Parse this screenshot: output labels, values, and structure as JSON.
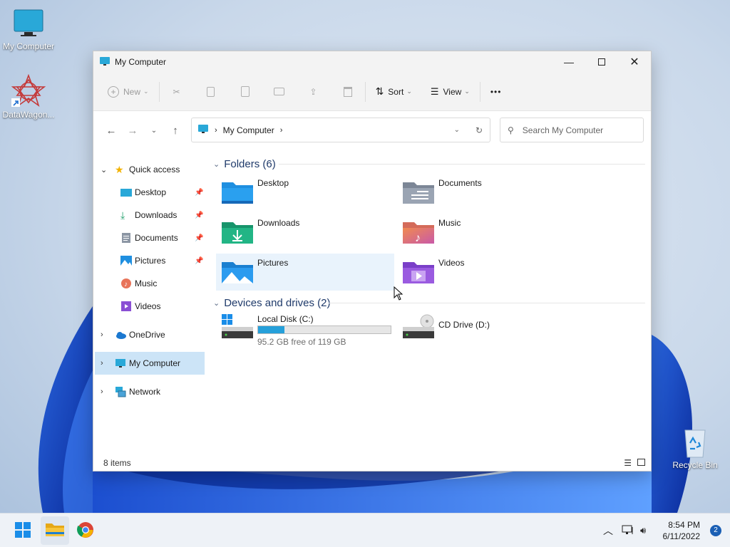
{
  "desktop": {
    "icons": [
      {
        "label": "My Computer",
        "icon": "monitor-icon"
      },
      {
        "label": "DataWagon...",
        "icon": "datawagon-shortcut-icon"
      },
      {
        "label": "Recycle Bin",
        "icon": "recycle-bin-icon"
      }
    ]
  },
  "window": {
    "title": "My Computer",
    "controls": [
      "minimize-icon",
      "maximize-icon",
      "close-icon"
    ]
  },
  "toolbar": {
    "new_label": "New",
    "sort_label": "Sort",
    "view_label": "View",
    "more_label": "•••"
  },
  "address": {
    "path": "My Computer",
    "search_placeholder": "Search My Computer"
  },
  "sidebar": {
    "quick_access": "Quick access",
    "items": [
      {
        "label": "Desktop",
        "icon": "desktop-icon",
        "pinned": true
      },
      {
        "label": "Downloads",
        "icon": "downloads-icon",
        "pinned": true
      },
      {
        "label": "Documents",
        "icon": "documents-icon",
        "pinned": true
      },
      {
        "label": "Pictures",
        "icon": "pictures-icon",
        "pinned": true
      },
      {
        "label": "Music",
        "icon": "music-icon",
        "pinned": false
      },
      {
        "label": "Videos",
        "icon": "videos-icon",
        "pinned": false
      }
    ],
    "onedrive": "OneDrive",
    "my_computer": "My Computer",
    "network": "Network"
  },
  "content": {
    "folders_header": "Folders (6)",
    "folders": [
      {
        "name": "Desktop",
        "icon": "desktop-folder-icon"
      },
      {
        "name": "Documents",
        "icon": "documents-folder-icon"
      },
      {
        "name": "Downloads",
        "icon": "downloads-folder-icon"
      },
      {
        "name": "Music",
        "icon": "music-folder-icon"
      },
      {
        "name": "Pictures",
        "icon": "pictures-folder-icon"
      },
      {
        "name": "Videos",
        "icon": "videos-folder-icon"
      }
    ],
    "drives_header": "Devices and drives (2)",
    "drives": [
      {
        "name": "Local Disk (C:)",
        "free_text": "95.2 GB free of 119 GB",
        "used_fraction": 0.2
      },
      {
        "name": "CD Drive (D:)"
      }
    ]
  },
  "status": {
    "items": "8 items"
  },
  "taskbar": {
    "time": "8:54 PM",
    "date": "6/11/2022",
    "notification_count": "2"
  },
  "colors": {
    "accent": "#26a0da",
    "selected": "#cce4f7"
  }
}
